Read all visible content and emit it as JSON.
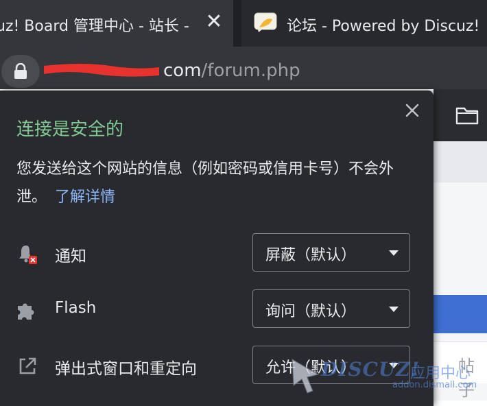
{
  "tabs": [
    {
      "title": "uz! Board 管理中心 - 站长 -",
      "close": "✕",
      "active": true
    },
    {
      "title": "论坛 - Powered by Discuz!",
      "active": false
    }
  ],
  "address_bar": {
    "host_visible": "com",
    "path": "/forum.php"
  },
  "site_info_popup": {
    "title": "连接是安全的",
    "description": "您发送给这个网站的信息（例如密码或信用卡号）不会外泄。",
    "learn_more": "了解详情",
    "close_icon": "close-icon",
    "permissions": [
      {
        "icon": "notification-bell-blocked-icon",
        "label": "通知",
        "value": "屏蔽（默认）"
      },
      {
        "icon": "puzzle-piece-icon",
        "label": "Flash",
        "value": "询问（默认）"
      },
      {
        "icon": "open-in-new-icon",
        "label": "弹出式窗口和重定向",
        "value": "允许（默认）"
      }
    ]
  },
  "watermark": {
    "brand": "DISCUZ!",
    "label": "应用中心",
    "url": "addon.dismall.com"
  },
  "page_behind": {
    "partial_text": "帖子"
  },
  "colors": {
    "tab_strip": "#1f2023",
    "popup_bg": "#292a2d",
    "secure_green": "#81c995",
    "link_blue": "#8ab4f8",
    "redaction_red": "#e8322e"
  }
}
